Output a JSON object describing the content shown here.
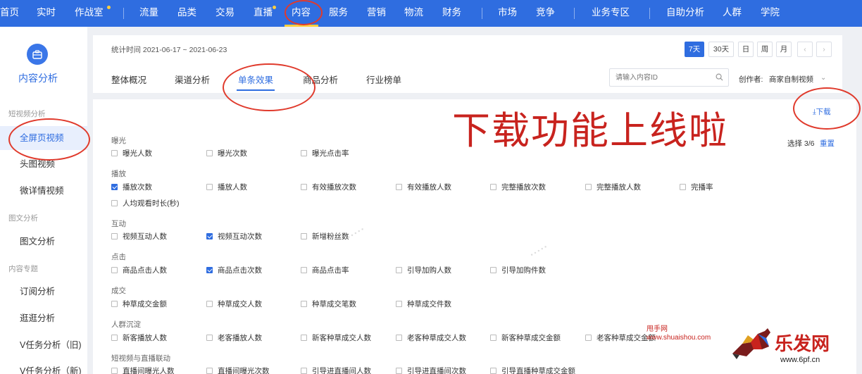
{
  "topnav": {
    "items": [
      "首页",
      "实时",
      "作战室",
      "流量",
      "品类",
      "交易",
      "直播",
      "内容",
      "服务",
      "营销",
      "物流",
      "财务",
      "市场",
      "竞争",
      "业务专区",
      "自助分析",
      "人群",
      "学院"
    ],
    "active": "内容"
  },
  "sidebar": {
    "title": "内容分析",
    "groups": [
      "短视频分析",
      "图文分析",
      "内容专题"
    ],
    "items": [
      "全屏页视频",
      "头图视频",
      "微详情视频",
      "图文分析",
      "订阅分析",
      "逛逛分析",
      "V任务分析（旧)",
      "V任务分析（新)"
    ],
    "active": "全屏页视频"
  },
  "header": {
    "stat_time": "统计时间 2021-06-17 ~ 2021-06-23",
    "date_buttons": [
      "7天",
      "30天",
      "日",
      "周",
      "月"
    ],
    "prev": "‹",
    "next": "›",
    "tabs": [
      "整体概况",
      "渠道分析",
      "单条效果",
      "商品分析",
      "行业榜单"
    ],
    "active_tab": "单条效果",
    "search_placeholder": "请输入内容ID",
    "creator_label": "创作者:",
    "creator_value": "商家自制视频"
  },
  "main": {
    "annotation": "下载功能上线啦",
    "download": "下载",
    "select_info": "选择 3/6",
    "reset": "重置",
    "sections": [
      {
        "title": "曝光",
        "items": [
          {
            "label": "曝光人数",
            "checked": false
          },
          {
            "label": "曝光次数",
            "checked": false
          },
          {
            "label": "曝光点击率",
            "checked": false
          }
        ]
      },
      {
        "title": "播放",
        "items": [
          {
            "label": "播放次数",
            "checked": true
          },
          {
            "label": "播放人数",
            "checked": false
          },
          {
            "label": "有效播放次数",
            "checked": false
          },
          {
            "label": "有效播放人数",
            "checked": false
          },
          {
            "label": "完整播放次数",
            "checked": false
          },
          {
            "label": "完整播放人数",
            "checked": false
          },
          {
            "label": "完播率",
            "checked": false
          },
          {
            "label": "人均观看时长(秒)",
            "checked": false
          }
        ]
      },
      {
        "title": "互动",
        "items": [
          {
            "label": "视频互动人数",
            "checked": false
          },
          {
            "label": "视频互动次数",
            "checked": true
          },
          {
            "label": "新增粉丝数",
            "checked": false
          }
        ]
      },
      {
        "title": "点击",
        "items": [
          {
            "label": "商品点击人数",
            "checked": false
          },
          {
            "label": "商品点击次数",
            "checked": true
          },
          {
            "label": "商品点击率",
            "checked": false
          },
          {
            "label": "引导加购人数",
            "checked": false
          },
          {
            "label": "引导加购件数",
            "checked": false
          }
        ]
      },
      {
        "title": "成交",
        "items": [
          {
            "label": "种草成交金额",
            "checked": false
          },
          {
            "label": "种草成交人数",
            "checked": false
          },
          {
            "label": "种草成交笔数",
            "checked": false
          },
          {
            "label": "种草成交件数",
            "checked": false
          }
        ]
      },
      {
        "title": "人群沉淀",
        "items": [
          {
            "label": "新客播放人数",
            "checked": false
          },
          {
            "label": "老客播放人数",
            "checked": false
          },
          {
            "label": "新客种草成交人数",
            "checked": false
          },
          {
            "label": "老客种草成交人数",
            "checked": false
          },
          {
            "label": "新客种草成交金额",
            "checked": false
          },
          {
            "label": "老客种草成交金额",
            "checked": false
          }
        ]
      },
      {
        "title": "短视频与直播联动",
        "items": [
          {
            "label": "直播间曝光人数",
            "checked": false
          },
          {
            "label": "直播间曝光次数",
            "checked": false
          },
          {
            "label": "引导进直播间人数",
            "checked": false
          },
          {
            "label": "引导进直播间次数",
            "checked": false
          },
          {
            "label": "引导直播种草成交金额",
            "checked": false
          }
        ]
      }
    ]
  },
  "watermark": {
    "site_cn": "甩手网",
    "site_url": "www.shuaishou.com",
    "brand": "乐发网",
    "brand_url": "www.6pf.cn"
  },
  "colors": {
    "nav": "#2f6de0",
    "accent": "#2f6de0",
    "annotation": "#c8231e"
  }
}
